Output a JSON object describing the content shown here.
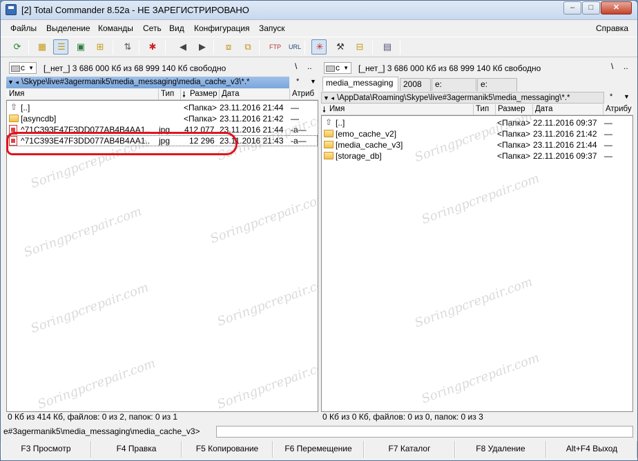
{
  "window": {
    "title": "[2] Total Commander 8.52a - НЕ ЗАРЕГИСТРИРОВАНО",
    "minimize": "–",
    "maximize": "□",
    "close": "✕"
  },
  "menu": {
    "items": [
      "Файлы",
      "Выделение",
      "Команды",
      "Сеть",
      "Вид",
      "Конфигурация",
      "Запуск"
    ],
    "help": "Справка"
  },
  "left": {
    "drive": "c",
    "free": "[_нет_]  3 686 000 Кб из 68 999 140 Кб свободно",
    "backslash": "\\",
    "dotdot": "..",
    "path": "\\Skype\\live#3agermanik5\\media_messaging\\media_cache_v3\\*.*",
    "cols": {
      "name": "Имя",
      "type": "Тип",
      "size": "Размер",
      "date": "Дата",
      "attr": "Атриб"
    },
    "rows": [
      {
        "name": "[..]",
        "type": "",
        "size": "<Папка>",
        "date": "23.11.2016 21:44",
        "attr": "—",
        "icon": "up-icon"
      },
      {
        "name": "[asyncdb]",
        "type": "",
        "size": "<Папка>",
        "date": "23.11.2016 21:42",
        "attr": "—",
        "icon": "folder-icon"
      },
      {
        "name": "^71C393E47F3DD077AB4B4AA1..",
        "type": "jpg",
        "size": "412 077",
        "date": "23.11.2016 21:44",
        "attr": "-a—",
        "icon": "jpg-icon"
      },
      {
        "name": "^71C393E47F3DD077AB4B4AA1..",
        "type": "jpg",
        "size": "12 296",
        "date": "23.11.2016 21:43",
        "attr": "-a—",
        "icon": "jpg-icon"
      }
    ],
    "status": "0 Кб из 414 Кб, файлов: 0 из 2, папок: 0 из 1"
  },
  "right": {
    "drive": "c",
    "free": "[_нет_]  3 686 000 Кб из 68 999 140 Кб свободно",
    "backslash": "\\",
    "dotdot": "..",
    "tabs": [
      "media_messaging",
      "2008",
      "e:",
      "e:"
    ],
    "path": "\\AppData\\Roaming\\Skype\\live#3agermanik5\\media_messaging\\*.*",
    "cols": {
      "name": "Имя",
      "type": "Тип",
      "size": "Размер",
      "date": "Дата",
      "attr": "Атрибу"
    },
    "rows": [
      {
        "name": "[..]",
        "type": "",
        "size": "<Папка>",
        "date": "22.11.2016 09:37",
        "attr": "—",
        "icon": "up-icon"
      },
      {
        "name": "[emo_cache_v2]",
        "type": "",
        "size": "<Папка>",
        "date": "23.11.2016 21:42",
        "attr": "—",
        "icon": "folder-icon"
      },
      {
        "name": "[media_cache_v3]",
        "type": "",
        "size": "<Папка>",
        "date": "23.11.2016 21:44",
        "attr": "—",
        "icon": "folder-icon"
      },
      {
        "name": "[storage_db]",
        "type": "",
        "size": "<Папка>",
        "date": "22.11.2016 09:37",
        "attr": "—",
        "icon": "folder-icon"
      }
    ],
    "status": "0 Кб из 0 Кб, файлов: 0 из 0, папок: 0 из 3"
  },
  "cmdline": {
    "path": "e#3agermanik5\\media_messaging\\media_cache_v3>",
    "value": ""
  },
  "fkeys": [
    "F3 Просмотр",
    "F4 Правка",
    "F5 Копирование",
    "F6 Перемещение",
    "F7 Каталог",
    "F8 Удаление",
    "Alt+F4 Выход"
  ],
  "pathbar_symbols": {
    "arrow": "▼ ◂",
    "star": "*",
    "down": "▼"
  },
  "watermark": "Soringpcrepair.com",
  "colors": {
    "accent": "#3b76c4",
    "highlight_ring": "#e0141e"
  }
}
